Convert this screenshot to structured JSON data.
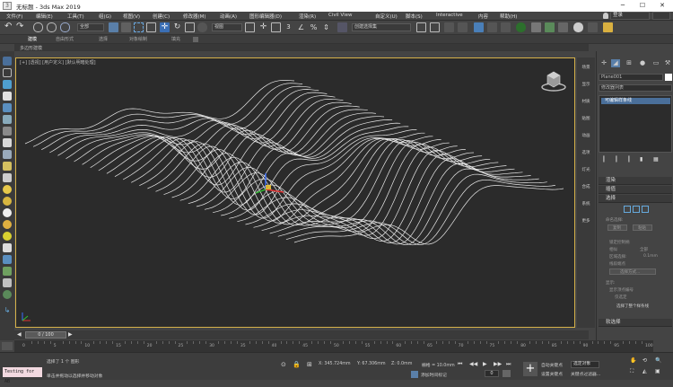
{
  "window": {
    "title": "无标题 - 3ds Max 2019",
    "min": "─",
    "max": "☐",
    "close": "✕"
  },
  "menus": [
    "文件(F)",
    "编辑(E)",
    "工具(T)",
    "组(G)",
    "视图(V)",
    "创建(C)",
    "修改器(M)",
    "动画(A)",
    "图形编辑器(D)",
    "渲染(R)",
    "Civil View",
    "自定义(U)",
    "脚本(S)",
    "Interactive",
    "内容",
    "帮助(H)"
  ],
  "user": "登录",
  "toolbar": {
    "filter_value": "全部",
    "coord_value": "视图",
    "selection_set": "创建选择集"
  },
  "ribbon": {
    "tabs": [
      "建模",
      "自由形式",
      "选择",
      "对象绘制",
      "填充"
    ],
    "subtab": "多边形建模"
  },
  "viewport": {
    "label": "[+] [透视] [用户定义] [默认明暗处理]"
  },
  "side_tabs": [
    "场景",
    "显示",
    "材质",
    "贴图",
    "动画",
    "选项",
    "灯光",
    "合成",
    "系统",
    "更多"
  ],
  "cmd_panel": {
    "name_field": "Plane001",
    "modifier_list": "修改器列表",
    "stack_item": "可编辑样条线",
    "rollouts": {
      "render": "渲染",
      "interp": "插值",
      "select": "选择",
      "soft": "软选择"
    },
    "select_labels": {
      "named": "命名选择:",
      "copy": "复制",
      "paste": "粘贴",
      "lock": "锁定控制柄",
      "same_type": "相似",
      "all": "全部",
      "area_sel": "区域选择:",
      "area_val": "0.1mm",
      "seg_end": "线段端点",
      "select_by": "选择方式...",
      "display": "显示:",
      "show_vert_num": "显示顶点编号",
      "only_sel": "仅选定",
      "status": "选择了整个样条线"
    }
  },
  "timeline": {
    "frame": "0 / 100",
    "ticks": [
      "0",
      "5",
      "10",
      "15",
      "20",
      "25",
      "30",
      "35",
      "40",
      "45",
      "50",
      "55",
      "60",
      "65",
      "70",
      "75",
      "80",
      "85",
      "90",
      "95",
      "100"
    ]
  },
  "status": {
    "maxscript": "Testing for AB",
    "msg1": "选择了 1 个 图形",
    "msg2": "单击并拖动以选择并移动对象",
    "x": "X: 345.724mm",
    "y": "Y: 67.306mm",
    "z": "Z: 0.0mm",
    "grid": "栅格 = 10.0mm",
    "add_marker": "添加时间标记",
    "autokey": "自动关键点",
    "setkey": "设置关键点",
    "sel_obj": "选定对象",
    "key_filter": "关键点过滤器...",
    "frame": "0"
  }
}
